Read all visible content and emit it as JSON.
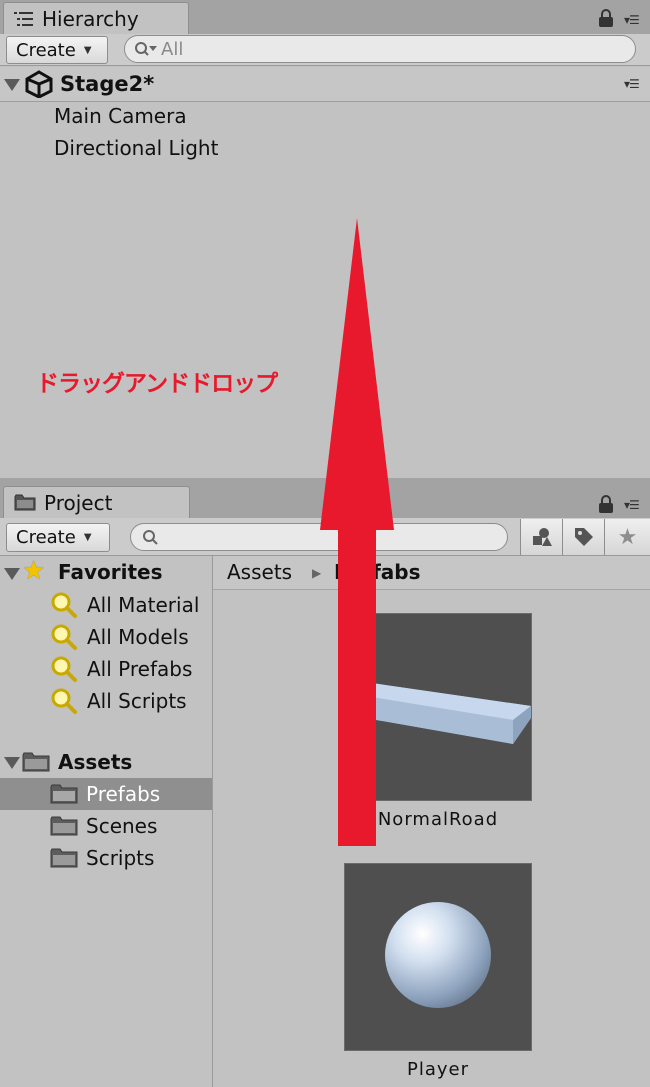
{
  "hierarchy": {
    "tab_label": "Hierarchy",
    "create_label": "Create",
    "search_placeholder": "All",
    "scene_name": "Stage2*",
    "items": [
      "Main Camera",
      "Directional Light"
    ]
  },
  "annotation": {
    "text": "ドラッグアンドドロップ",
    "color": "#e8192c"
  },
  "project": {
    "tab_label": "Project",
    "create_label": "Create",
    "search_placeholder": "",
    "favorites": {
      "label": "Favorites",
      "items": [
        "All Material",
        "All Models",
        "All Prefabs",
        "All Scripts"
      ]
    },
    "assets": {
      "label": "Assets",
      "items": [
        "Prefabs",
        "Scenes",
        "Scripts"
      ],
      "selected": "Prefabs"
    },
    "breadcrumb": [
      "Assets",
      "Prefabs"
    ],
    "grid_items": [
      {
        "name": "NormalRoad",
        "icon": "road-prefab-icon"
      },
      {
        "name": "Player",
        "icon": "sphere-prefab-icon"
      }
    ]
  }
}
